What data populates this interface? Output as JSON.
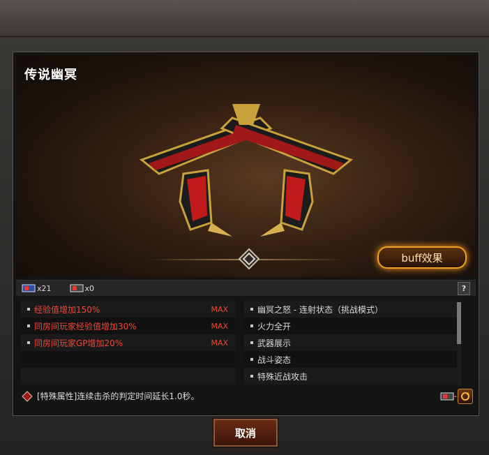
{
  "weapon": {
    "title": "传说幽冥"
  },
  "buff_button": "buff效果",
  "counts": [
    {
      "icon": "card-icon",
      "text": "x21"
    },
    {
      "icon": "card-icon",
      "text": "x0"
    }
  ],
  "help": "?",
  "left_list": [
    {
      "text": "经验值增加150%",
      "max": "MAX"
    },
    {
      "text": "同房间玩家经验值增加30%",
      "max": "MAX"
    },
    {
      "text": "同房间玩家GP增加20%",
      "max": "MAX"
    },
    {
      "text": "",
      "max": ""
    },
    {
      "text": "",
      "max": ""
    }
  ],
  "right_list": [
    {
      "text": "幽冥之怒 - 连射状态（挑战模式）"
    },
    {
      "text": "火力全开"
    },
    {
      "text": "武器展示"
    },
    {
      "text": "战斗姿态"
    },
    {
      "text": "特殊近战攻击"
    }
  ],
  "special": "[特殊属性]连续击杀的判定时间延长1.0秒。",
  "cost": "-1",
  "cancel_button": "取消",
  "colors": {
    "accent": "#f0a020",
    "highlight": "#e8493a"
  }
}
